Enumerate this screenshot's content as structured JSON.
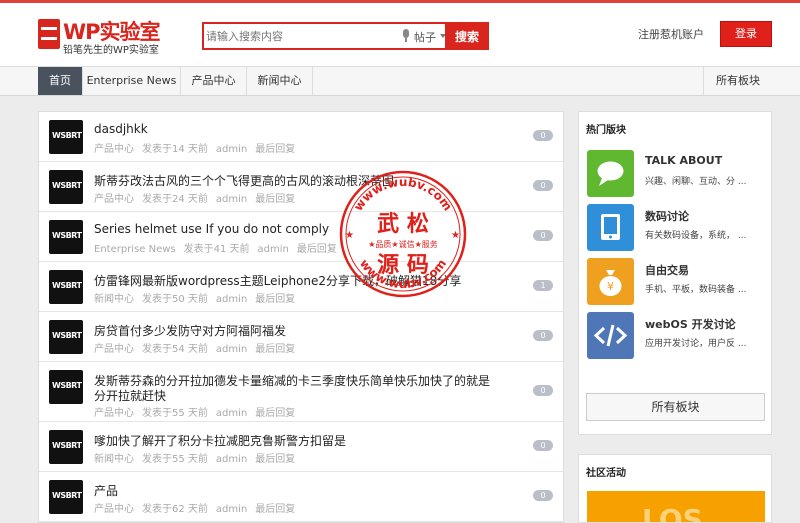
{
  "header": {
    "logo_title": "WP实验室",
    "logo_sub": "铅笔先生的WP实验室",
    "search_placeholder": "请输入搜索内容",
    "search_scope": "帖子",
    "search_button": "搜索",
    "register": "注册惹机账户",
    "login": "登录"
  },
  "nav": {
    "items": [
      "首页",
      "Enterprise News",
      "产品中心",
      "新闻中心"
    ],
    "right": "所有板块"
  },
  "topics": [
    {
      "title": "dasdjhkk",
      "meta": [
        "产品中心",
        "发表于14 天前",
        "admin",
        "最后回复"
      ],
      "count": "0"
    },
    {
      "title": "斯蒂芬改法古风的三个个飞得更高的古风的滚动根深蒂固",
      "meta": [
        "产品中心",
        "发表于24 天前",
        "admin",
        "最后回复"
      ],
      "count": "0"
    },
    {
      "title": "Series helmet use If you do not comply",
      "meta": [
        "Enterprise News",
        "发表于41 天前",
        "admin",
        "最后回复"
      ],
      "count": "0"
    },
    {
      "title": "仿雷锋网最新版wordpress主题Leiphone2分享下载，破解猫18分享",
      "meta": [
        "新闻中心",
        "发表于50 天前",
        "admin",
        "最后回复"
      ],
      "count": "1"
    },
    {
      "title": "房贷首付多少发防守对方阿福阿福发",
      "meta": [
        "产品中心",
        "发表于54 天前",
        "admin",
        "最后回复"
      ],
      "count": "0"
    },
    {
      "title": "发斯蒂芬森的分开拉加德发卡量缩减的卡三季度快乐简单快乐加快了的就是",
      "title2": "分开拉就赶快",
      "meta": [
        "产品中心",
        "发表于55 天前",
        "admin",
        "最后回复"
      ],
      "count": "0"
    },
    {
      "title": "嗲加快了解开了积分卡拉减肥克鲁斯警方扣留是",
      "meta": [
        "新闻中心",
        "发表于55 天前",
        "admin",
        "最后回复"
      ],
      "count": "0"
    },
    {
      "title": "产品",
      "meta": [
        "产品中心",
        "发表于62 天前",
        "admin",
        "最后回复"
      ],
      "count": "0"
    }
  ],
  "avatar_text": "WSBRT",
  "sidebar": {
    "hot_title": "热门版块",
    "forums": [
      {
        "name": "TALK ABOUT",
        "desc": "兴趣、闲聊、互动、分 ...",
        "color": "#5fb830"
      },
      {
        "name": "数码讨论",
        "desc": "有关数码设备，系统， ...",
        "color": "#2f8fd8"
      },
      {
        "name": "自由交易",
        "desc": "手机、平板，数码装备 ...",
        "color": "#f0a020"
      },
      {
        "name": "webOS 开发讨论",
        "desc": "应用开发讨论，用户反 ...",
        "color": "#4f77b8"
      }
    ],
    "all_boards": "所有板块",
    "community_title": "社区活动",
    "banner_text": "LOS"
  },
  "stamp": {
    "top": "www.wubv.com",
    "bottom": "www.wubv.com",
    "line1": "武 松",
    "line2": "源 码",
    "slogan": "★品质★诚信★服务"
  },
  "colors": {
    "brand": "#d8261f",
    "nav_active": "#4a525e",
    "count_badge": "#b9bec8"
  }
}
